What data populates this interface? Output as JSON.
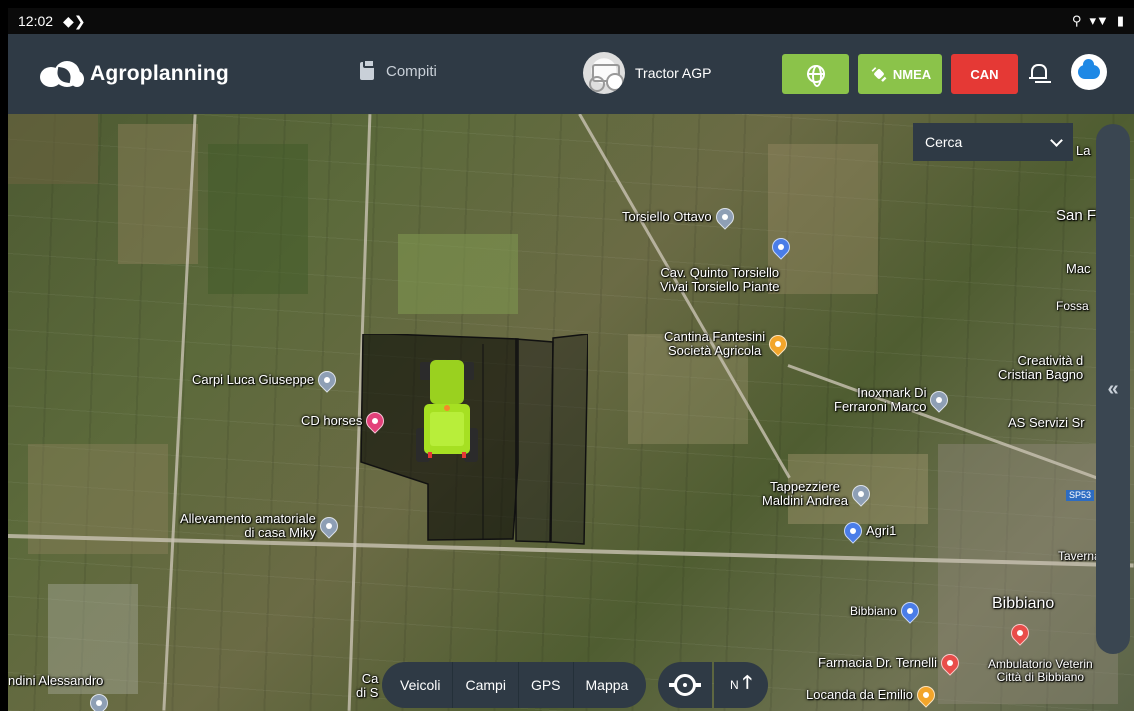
{
  "status_bar": {
    "time": "12:02"
  },
  "header": {
    "brand": "Agroplanning",
    "nav_tasks": "Compiti",
    "vehicle_name": "Tractor AGP",
    "btn_nmea": "NMEA",
    "btn_can": "CAN"
  },
  "map": {
    "search_placeholder": "Cerca",
    "pois": [
      {
        "label": "Torsiello Ottavo"
      },
      {
        "label": "Cav. Quinto Torsiello\nVivai Torsiello Piante"
      },
      {
        "label": "Cantina Fantesini\nSocietà Agricola"
      },
      {
        "label": "Carpi Luca Giuseppe"
      },
      {
        "label": "CD horses"
      },
      {
        "label": "Inoxmark Di\nFerraroni Marco"
      },
      {
        "label": "Creatività d\nCristian Bagno"
      },
      {
        "label": "AS Servizi Sr"
      },
      {
        "label": "Tappezziere\nMaldini Andrea"
      },
      {
        "label": "Agri1"
      },
      {
        "label": "Allevamento amatoriale\ndi casa Miky"
      },
      {
        "label": "Bibbiano"
      },
      {
        "label": "Bibbiano"
      },
      {
        "label": "Farmacia Dr. Ternelli"
      },
      {
        "label": "Ambulatorio Veterin\nCittà di Bibbiano"
      },
      {
        "label": "Locanda da Emilio"
      },
      {
        "label": "ndini Alessandro"
      },
      {
        "label": "San Fil"
      },
      {
        "label": "Mac"
      },
      {
        "label": "Fossa"
      },
      {
        "label": "Taverna B"
      },
      {
        "label": "La"
      },
      {
        "label": "SP53"
      },
      {
        "label": "Ca\ndi S"
      }
    ],
    "bottom_tabs": [
      "Veicoli",
      "Campi",
      "GPS",
      "Mappa"
    ],
    "north_label": "N"
  },
  "colors": {
    "header_bg": "#2f3a45",
    "accent_green": "#8bc34a",
    "can_red": "#e53935",
    "tractor_green": "#a6e022"
  }
}
